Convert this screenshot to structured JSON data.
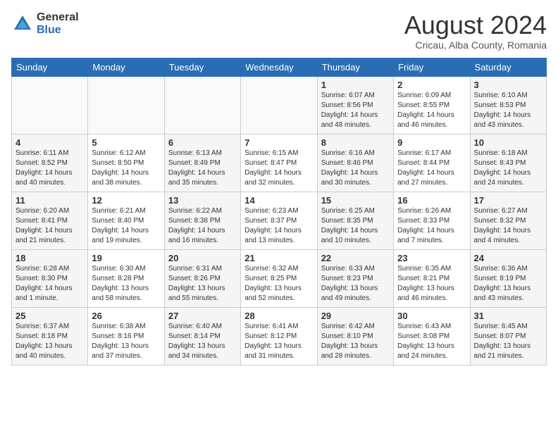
{
  "header": {
    "logo": {
      "general": "General",
      "blue": "Blue"
    },
    "title": "August 2024",
    "location": "Cricau, Alba County, Romania"
  },
  "calendar": {
    "days_of_week": [
      "Sunday",
      "Monday",
      "Tuesday",
      "Wednesday",
      "Thursday",
      "Friday",
      "Saturday"
    ],
    "weeks": [
      [
        {
          "day": "",
          "info": ""
        },
        {
          "day": "",
          "info": ""
        },
        {
          "day": "",
          "info": ""
        },
        {
          "day": "",
          "info": ""
        },
        {
          "day": "1",
          "info": "Sunrise: 6:07 AM\nSunset: 8:56 PM\nDaylight: 14 hours\nand 48 minutes."
        },
        {
          "day": "2",
          "info": "Sunrise: 6:09 AM\nSunset: 8:55 PM\nDaylight: 14 hours\nand 46 minutes."
        },
        {
          "day": "3",
          "info": "Sunrise: 6:10 AM\nSunset: 8:53 PM\nDaylight: 14 hours\nand 43 minutes."
        }
      ],
      [
        {
          "day": "4",
          "info": "Sunrise: 6:11 AM\nSunset: 8:52 PM\nDaylight: 14 hours\nand 40 minutes."
        },
        {
          "day": "5",
          "info": "Sunrise: 6:12 AM\nSunset: 8:50 PM\nDaylight: 14 hours\nand 38 minutes."
        },
        {
          "day": "6",
          "info": "Sunrise: 6:13 AM\nSunset: 8:49 PM\nDaylight: 14 hours\nand 35 minutes."
        },
        {
          "day": "7",
          "info": "Sunrise: 6:15 AM\nSunset: 8:47 PM\nDaylight: 14 hours\nand 32 minutes."
        },
        {
          "day": "8",
          "info": "Sunrise: 6:16 AM\nSunset: 8:46 PM\nDaylight: 14 hours\nand 30 minutes."
        },
        {
          "day": "9",
          "info": "Sunrise: 6:17 AM\nSunset: 8:44 PM\nDaylight: 14 hours\nand 27 minutes."
        },
        {
          "day": "10",
          "info": "Sunrise: 6:18 AM\nSunset: 8:43 PM\nDaylight: 14 hours\nand 24 minutes."
        }
      ],
      [
        {
          "day": "11",
          "info": "Sunrise: 6:20 AM\nSunset: 8:41 PM\nDaylight: 14 hours\nand 21 minutes."
        },
        {
          "day": "12",
          "info": "Sunrise: 6:21 AM\nSunset: 8:40 PM\nDaylight: 14 hours\nand 19 minutes."
        },
        {
          "day": "13",
          "info": "Sunrise: 6:22 AM\nSunset: 8:38 PM\nDaylight: 14 hours\nand 16 minutes."
        },
        {
          "day": "14",
          "info": "Sunrise: 6:23 AM\nSunset: 8:37 PM\nDaylight: 14 hours\nand 13 minutes."
        },
        {
          "day": "15",
          "info": "Sunrise: 6:25 AM\nSunset: 8:35 PM\nDaylight: 14 hours\nand 10 minutes."
        },
        {
          "day": "16",
          "info": "Sunrise: 6:26 AM\nSunset: 8:33 PM\nDaylight: 14 hours\nand 7 minutes."
        },
        {
          "day": "17",
          "info": "Sunrise: 6:27 AM\nSunset: 8:32 PM\nDaylight: 14 hours\nand 4 minutes."
        }
      ],
      [
        {
          "day": "18",
          "info": "Sunrise: 6:28 AM\nSunset: 8:30 PM\nDaylight: 14 hours\nand 1 minute."
        },
        {
          "day": "19",
          "info": "Sunrise: 6:30 AM\nSunset: 8:28 PM\nDaylight: 13 hours\nand 58 minutes."
        },
        {
          "day": "20",
          "info": "Sunrise: 6:31 AM\nSunset: 8:26 PM\nDaylight: 13 hours\nand 55 minutes."
        },
        {
          "day": "21",
          "info": "Sunrise: 6:32 AM\nSunset: 8:25 PM\nDaylight: 13 hours\nand 52 minutes."
        },
        {
          "day": "22",
          "info": "Sunrise: 6:33 AM\nSunset: 8:23 PM\nDaylight: 13 hours\nand 49 minutes."
        },
        {
          "day": "23",
          "info": "Sunrise: 6:35 AM\nSunset: 8:21 PM\nDaylight: 13 hours\nand 46 minutes."
        },
        {
          "day": "24",
          "info": "Sunrise: 6:36 AM\nSunset: 8:19 PM\nDaylight: 13 hours\nand 43 minutes."
        }
      ],
      [
        {
          "day": "25",
          "info": "Sunrise: 6:37 AM\nSunset: 8:18 PM\nDaylight: 13 hours\nand 40 minutes."
        },
        {
          "day": "26",
          "info": "Sunrise: 6:38 AM\nSunset: 8:16 PM\nDaylight: 13 hours\nand 37 minutes."
        },
        {
          "day": "27",
          "info": "Sunrise: 6:40 AM\nSunset: 8:14 PM\nDaylight: 13 hours\nand 34 minutes."
        },
        {
          "day": "28",
          "info": "Sunrise: 6:41 AM\nSunset: 8:12 PM\nDaylight: 13 hours\nand 31 minutes."
        },
        {
          "day": "29",
          "info": "Sunrise: 6:42 AM\nSunset: 8:10 PM\nDaylight: 13 hours\nand 28 minutes."
        },
        {
          "day": "30",
          "info": "Sunrise: 6:43 AM\nSunset: 8:08 PM\nDaylight: 13 hours\nand 24 minutes."
        },
        {
          "day": "31",
          "info": "Sunrise: 6:45 AM\nSunset: 8:07 PM\nDaylight: 13 hours\nand 21 minutes."
        }
      ]
    ]
  }
}
